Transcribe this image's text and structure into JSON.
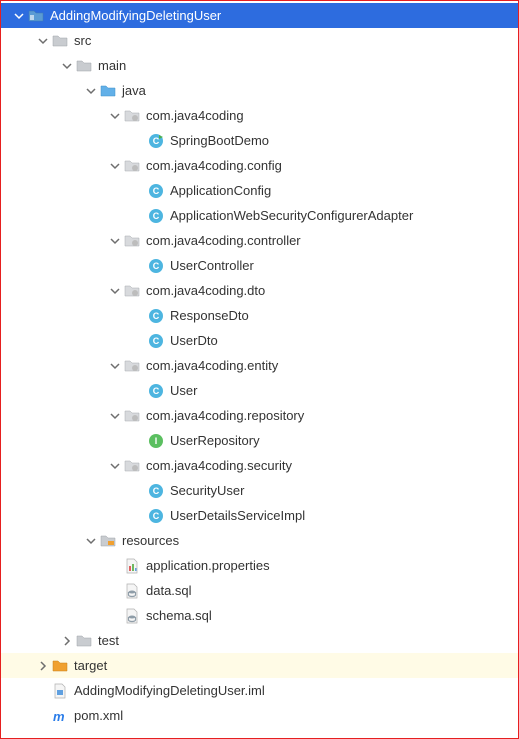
{
  "tree": [
    {
      "depth": 0,
      "arrow": "down",
      "icon": "project-folder",
      "label": "AddingModifyingDeletingUser",
      "selected": true,
      "interactable": true
    },
    {
      "depth": 1,
      "arrow": "down",
      "icon": "folder-gray",
      "label": "src",
      "interactable": true
    },
    {
      "depth": 2,
      "arrow": "down",
      "icon": "folder-gray",
      "label": "main",
      "interactable": true
    },
    {
      "depth": 3,
      "arrow": "down",
      "icon": "folder-source",
      "label": "java",
      "interactable": true
    },
    {
      "depth": 4,
      "arrow": "down",
      "icon": "package",
      "label": "com.java4coding",
      "interactable": true
    },
    {
      "depth": 5,
      "arrow": "none",
      "icon": "class-run",
      "label": "SpringBootDemo",
      "interactable": true
    },
    {
      "depth": 4,
      "arrow": "down",
      "icon": "package",
      "label": "com.java4coding.config",
      "interactable": true
    },
    {
      "depth": 5,
      "arrow": "none",
      "icon": "class",
      "label": "ApplicationConfig",
      "interactable": true
    },
    {
      "depth": 5,
      "arrow": "none",
      "icon": "class",
      "label": "ApplicationWebSecurityConfigurerAdapter",
      "interactable": true
    },
    {
      "depth": 4,
      "arrow": "down",
      "icon": "package",
      "label": "com.java4coding.controller",
      "interactable": true
    },
    {
      "depth": 5,
      "arrow": "none",
      "icon": "class",
      "label": "UserController",
      "interactable": true
    },
    {
      "depth": 4,
      "arrow": "down",
      "icon": "package",
      "label": "com.java4coding.dto",
      "interactable": true
    },
    {
      "depth": 5,
      "arrow": "none",
      "icon": "class",
      "label": "ResponseDto",
      "interactable": true
    },
    {
      "depth": 5,
      "arrow": "none",
      "icon": "class",
      "label": "UserDto",
      "interactable": true
    },
    {
      "depth": 4,
      "arrow": "down",
      "icon": "package",
      "label": "com.java4coding.entity",
      "interactable": true
    },
    {
      "depth": 5,
      "arrow": "none",
      "icon": "class",
      "label": "User",
      "interactable": true
    },
    {
      "depth": 4,
      "arrow": "down",
      "icon": "package",
      "label": "com.java4coding.repository",
      "interactable": true
    },
    {
      "depth": 5,
      "arrow": "none",
      "icon": "interface",
      "label": "UserRepository",
      "interactable": true
    },
    {
      "depth": 4,
      "arrow": "down",
      "icon": "package",
      "label": "com.java4coding.security",
      "interactable": true
    },
    {
      "depth": 5,
      "arrow": "none",
      "icon": "class",
      "label": "SecurityUser",
      "interactable": true
    },
    {
      "depth": 5,
      "arrow": "none",
      "icon": "class",
      "label": "UserDetailsServiceImpl",
      "interactable": true
    },
    {
      "depth": 3,
      "arrow": "down",
      "icon": "folder-resources",
      "label": "resources",
      "interactable": true
    },
    {
      "depth": 4,
      "arrow": "none",
      "icon": "properties-file",
      "label": "application.properties",
      "interactable": true
    },
    {
      "depth": 4,
      "arrow": "none",
      "icon": "sql-file",
      "label": "data.sql",
      "interactable": true
    },
    {
      "depth": 4,
      "arrow": "none",
      "icon": "sql-file",
      "label": "schema.sql",
      "interactable": true
    },
    {
      "depth": 2,
      "arrow": "right",
      "icon": "folder-gray",
      "label": "test",
      "interactable": true
    },
    {
      "depth": 1,
      "arrow": "right",
      "icon": "folder-target",
      "label": "target",
      "highlight": true,
      "interactable": true
    },
    {
      "depth": 1,
      "arrow": "none",
      "icon": "iml-file",
      "label": "AddingModifyingDeletingUser.iml",
      "interactable": true
    },
    {
      "depth": 1,
      "arrow": "none",
      "icon": "maven-file",
      "label": "pom.xml",
      "interactable": true
    }
  ]
}
